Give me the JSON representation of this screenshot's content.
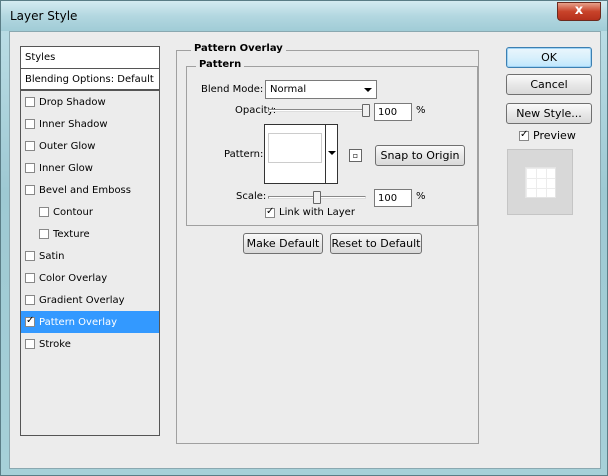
{
  "window": {
    "title": "Layer Style",
    "close_label": "x"
  },
  "styles_panel": {
    "header": "Styles",
    "blending_options": "Blending Options: Default",
    "items": [
      {
        "label": "Drop Shadow",
        "checked": false
      },
      {
        "label": "Inner Shadow",
        "checked": false
      },
      {
        "label": "Outer Glow",
        "checked": false
      },
      {
        "label": "Inner Glow",
        "checked": false
      },
      {
        "label": "Bevel and Emboss",
        "checked": false
      },
      {
        "label": "Contour",
        "checked": false,
        "indent": true
      },
      {
        "label": "Texture",
        "checked": false,
        "indent": true
      },
      {
        "label": "Satin",
        "checked": false
      },
      {
        "label": "Color Overlay",
        "checked": false
      },
      {
        "label": "Gradient Overlay",
        "checked": false
      },
      {
        "label": "Pattern Overlay",
        "checked": true,
        "selected": true
      },
      {
        "label": "Stroke",
        "checked": false
      }
    ]
  },
  "pattern_overlay": {
    "group_title": "Pattern Overlay",
    "subgroup_title": "Pattern",
    "blend_mode_label": "Blend Mode:",
    "blend_mode_value": "Normal",
    "opacity_label": "Opacity:",
    "opacity_value": "100",
    "opacity_unit": "%",
    "pattern_label": "Pattern:",
    "snap_button": "Snap to Origin",
    "scale_label": "Scale:",
    "scale_value": "100",
    "scale_unit": "%",
    "link_with_layer_label": "Link with Layer",
    "link_with_layer_checked": true,
    "make_default_button": "Make Default",
    "reset_default_button": "Reset to Default"
  },
  "right_buttons": {
    "ok": "OK",
    "cancel": "Cancel",
    "new_style": "New Style...",
    "preview_label": "Preview",
    "preview_checked": true
  }
}
